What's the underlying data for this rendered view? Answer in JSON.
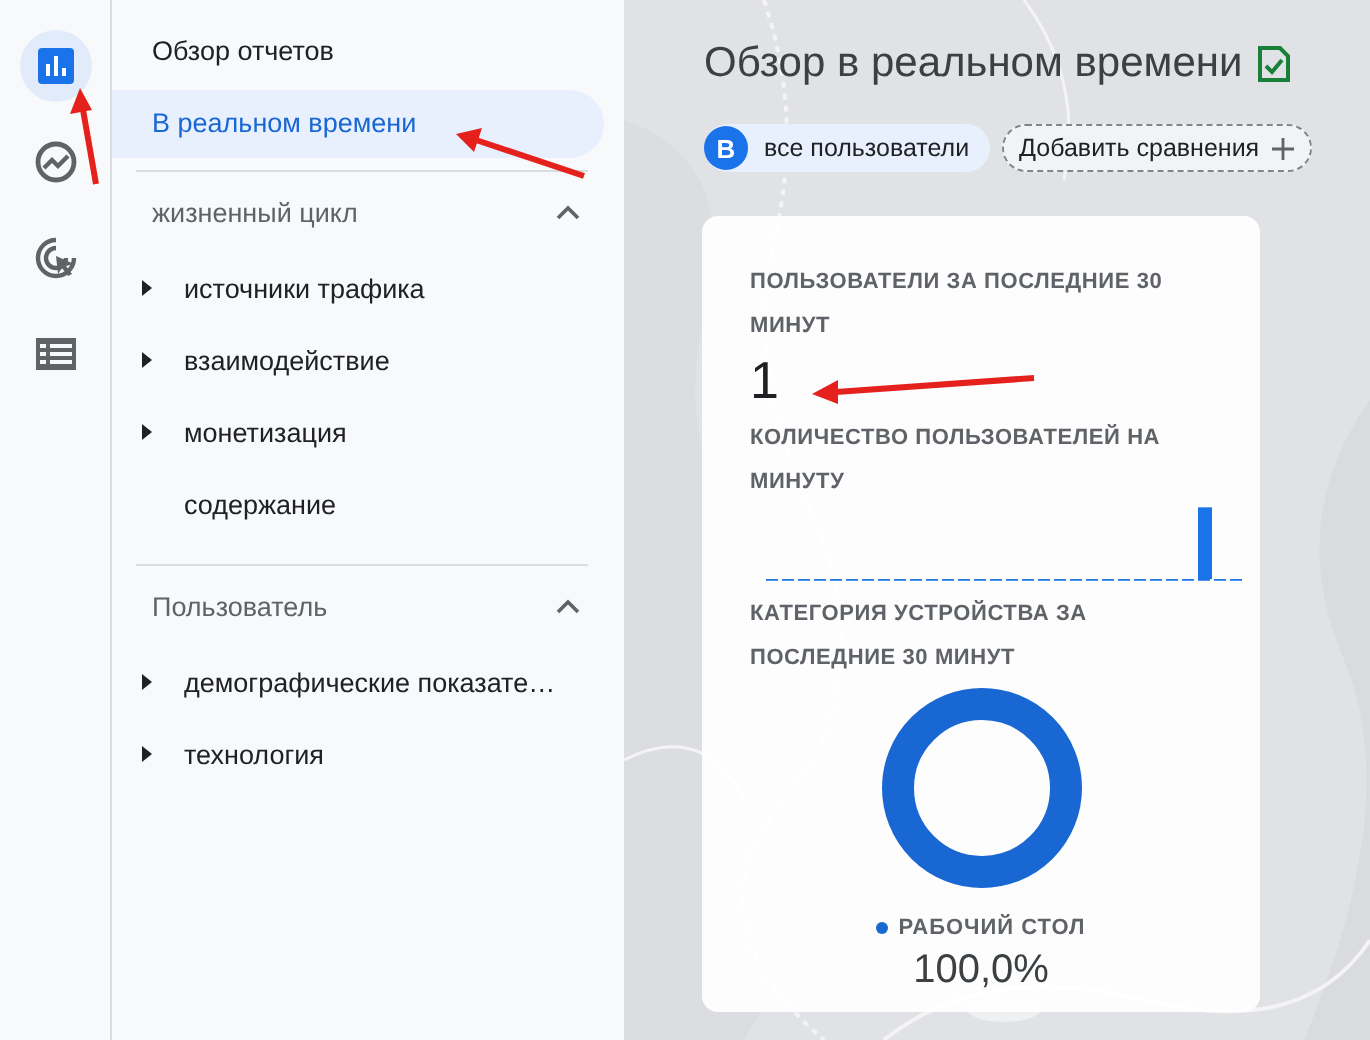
{
  "nav_rail": [
    {
      "kind": "reports",
      "selected": true
    },
    {
      "kind": "explore",
      "selected": false
    },
    {
      "kind": "advertising",
      "selected": false
    },
    {
      "kind": "configure",
      "selected": false
    }
  ],
  "sidebar": {
    "items": [
      {
        "label": "Обзор отчетов",
        "selected": false
      },
      {
        "label": "В реальном времени",
        "selected": true
      }
    ],
    "sections": [
      {
        "title": "жизненный цикл",
        "expanded": true,
        "items": [
          {
            "label": "источники трафика",
            "has_children": true
          },
          {
            "label": "взаимодействие",
            "has_children": true
          },
          {
            "label": "монетизация",
            "has_children": true
          },
          {
            "label": "содержание",
            "has_children": false
          }
        ]
      },
      {
        "title": "Пользователь",
        "expanded": true,
        "items": [
          {
            "label": "демографические показате…",
            "has_children": true
          },
          {
            "label": "технология",
            "has_children": true
          }
        ]
      }
    ]
  },
  "page": {
    "title": "Обзор в реальном времени",
    "segment": {
      "badge": "B",
      "label": "все пользователи"
    },
    "add_comparison": "Добавить сравнения"
  },
  "card": {
    "users_title": "ПОЛЬЗОВАТЕЛИ ЗА ПОСЛЕДНИЕ 30 МИНУТ",
    "users_value": "1",
    "per_minute_title": "КОЛИЧЕСТВО ПОЛЬЗОВАТЕЛЕЙ НА МИНУТУ",
    "device_title": "КАТЕГОРИЯ УСТРОЙСТВА ЗА ПОСЛЕДНИЕ 30 МИНУТ",
    "device_legend": [
      {
        "label": "РАБОЧИЙ СТОЛ",
        "color": "#1967d2"
      }
    ],
    "device_share": "100,0%"
  }
}
